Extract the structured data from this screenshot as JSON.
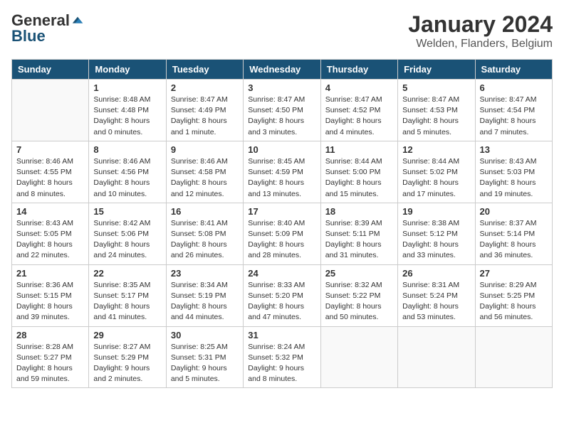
{
  "logo": {
    "general": "General",
    "blue": "Blue"
  },
  "header": {
    "title": "January 2024",
    "location": "Welden, Flanders, Belgium"
  },
  "weekdays": [
    "Sunday",
    "Monday",
    "Tuesday",
    "Wednesday",
    "Thursday",
    "Friday",
    "Saturday"
  ],
  "weeks": [
    [
      {
        "day": "",
        "sunrise": "",
        "sunset": "",
        "daylight": ""
      },
      {
        "day": "1",
        "sunrise": "Sunrise: 8:48 AM",
        "sunset": "Sunset: 4:48 PM",
        "daylight": "Daylight: 8 hours and 0 minutes."
      },
      {
        "day": "2",
        "sunrise": "Sunrise: 8:47 AM",
        "sunset": "Sunset: 4:49 PM",
        "daylight": "Daylight: 8 hours and 1 minute."
      },
      {
        "day": "3",
        "sunrise": "Sunrise: 8:47 AM",
        "sunset": "Sunset: 4:50 PM",
        "daylight": "Daylight: 8 hours and 3 minutes."
      },
      {
        "day": "4",
        "sunrise": "Sunrise: 8:47 AM",
        "sunset": "Sunset: 4:52 PM",
        "daylight": "Daylight: 8 hours and 4 minutes."
      },
      {
        "day": "5",
        "sunrise": "Sunrise: 8:47 AM",
        "sunset": "Sunset: 4:53 PM",
        "daylight": "Daylight: 8 hours and 5 minutes."
      },
      {
        "day": "6",
        "sunrise": "Sunrise: 8:47 AM",
        "sunset": "Sunset: 4:54 PM",
        "daylight": "Daylight: 8 hours and 7 minutes."
      }
    ],
    [
      {
        "day": "7",
        "sunrise": "Sunrise: 8:46 AM",
        "sunset": "Sunset: 4:55 PM",
        "daylight": "Daylight: 8 hours and 8 minutes."
      },
      {
        "day": "8",
        "sunrise": "Sunrise: 8:46 AM",
        "sunset": "Sunset: 4:56 PM",
        "daylight": "Daylight: 8 hours and 10 minutes."
      },
      {
        "day": "9",
        "sunrise": "Sunrise: 8:46 AM",
        "sunset": "Sunset: 4:58 PM",
        "daylight": "Daylight: 8 hours and 12 minutes."
      },
      {
        "day": "10",
        "sunrise": "Sunrise: 8:45 AM",
        "sunset": "Sunset: 4:59 PM",
        "daylight": "Daylight: 8 hours and 13 minutes."
      },
      {
        "day": "11",
        "sunrise": "Sunrise: 8:44 AM",
        "sunset": "Sunset: 5:00 PM",
        "daylight": "Daylight: 8 hours and 15 minutes."
      },
      {
        "day": "12",
        "sunrise": "Sunrise: 8:44 AM",
        "sunset": "Sunset: 5:02 PM",
        "daylight": "Daylight: 8 hours and 17 minutes."
      },
      {
        "day": "13",
        "sunrise": "Sunrise: 8:43 AM",
        "sunset": "Sunset: 5:03 PM",
        "daylight": "Daylight: 8 hours and 19 minutes."
      }
    ],
    [
      {
        "day": "14",
        "sunrise": "Sunrise: 8:43 AM",
        "sunset": "Sunset: 5:05 PM",
        "daylight": "Daylight: 8 hours and 22 minutes."
      },
      {
        "day": "15",
        "sunrise": "Sunrise: 8:42 AM",
        "sunset": "Sunset: 5:06 PM",
        "daylight": "Daylight: 8 hours and 24 minutes."
      },
      {
        "day": "16",
        "sunrise": "Sunrise: 8:41 AM",
        "sunset": "Sunset: 5:08 PM",
        "daylight": "Daylight: 8 hours and 26 minutes."
      },
      {
        "day": "17",
        "sunrise": "Sunrise: 8:40 AM",
        "sunset": "Sunset: 5:09 PM",
        "daylight": "Daylight: 8 hours and 28 minutes."
      },
      {
        "day": "18",
        "sunrise": "Sunrise: 8:39 AM",
        "sunset": "Sunset: 5:11 PM",
        "daylight": "Daylight: 8 hours and 31 minutes."
      },
      {
        "day": "19",
        "sunrise": "Sunrise: 8:38 AM",
        "sunset": "Sunset: 5:12 PM",
        "daylight": "Daylight: 8 hours and 33 minutes."
      },
      {
        "day": "20",
        "sunrise": "Sunrise: 8:37 AM",
        "sunset": "Sunset: 5:14 PM",
        "daylight": "Daylight: 8 hours and 36 minutes."
      }
    ],
    [
      {
        "day": "21",
        "sunrise": "Sunrise: 8:36 AM",
        "sunset": "Sunset: 5:15 PM",
        "daylight": "Daylight: 8 hours and 39 minutes."
      },
      {
        "day": "22",
        "sunrise": "Sunrise: 8:35 AM",
        "sunset": "Sunset: 5:17 PM",
        "daylight": "Daylight: 8 hours and 41 minutes."
      },
      {
        "day": "23",
        "sunrise": "Sunrise: 8:34 AM",
        "sunset": "Sunset: 5:19 PM",
        "daylight": "Daylight: 8 hours and 44 minutes."
      },
      {
        "day": "24",
        "sunrise": "Sunrise: 8:33 AM",
        "sunset": "Sunset: 5:20 PM",
        "daylight": "Daylight: 8 hours and 47 minutes."
      },
      {
        "day": "25",
        "sunrise": "Sunrise: 8:32 AM",
        "sunset": "Sunset: 5:22 PM",
        "daylight": "Daylight: 8 hours and 50 minutes."
      },
      {
        "day": "26",
        "sunrise": "Sunrise: 8:31 AM",
        "sunset": "Sunset: 5:24 PM",
        "daylight": "Daylight: 8 hours and 53 minutes."
      },
      {
        "day": "27",
        "sunrise": "Sunrise: 8:29 AM",
        "sunset": "Sunset: 5:25 PM",
        "daylight": "Daylight: 8 hours and 56 minutes."
      }
    ],
    [
      {
        "day": "28",
        "sunrise": "Sunrise: 8:28 AM",
        "sunset": "Sunset: 5:27 PM",
        "daylight": "Daylight: 8 hours and 59 minutes."
      },
      {
        "day": "29",
        "sunrise": "Sunrise: 8:27 AM",
        "sunset": "Sunset: 5:29 PM",
        "daylight": "Daylight: 9 hours and 2 minutes."
      },
      {
        "day": "30",
        "sunrise": "Sunrise: 8:25 AM",
        "sunset": "Sunset: 5:31 PM",
        "daylight": "Daylight: 9 hours and 5 minutes."
      },
      {
        "day": "31",
        "sunrise": "Sunrise: 8:24 AM",
        "sunset": "Sunset: 5:32 PM",
        "daylight": "Daylight: 9 hours and 8 minutes."
      },
      {
        "day": "",
        "sunrise": "",
        "sunset": "",
        "daylight": ""
      },
      {
        "day": "",
        "sunrise": "",
        "sunset": "",
        "daylight": ""
      },
      {
        "day": "",
        "sunrise": "",
        "sunset": "",
        "daylight": ""
      }
    ]
  ]
}
